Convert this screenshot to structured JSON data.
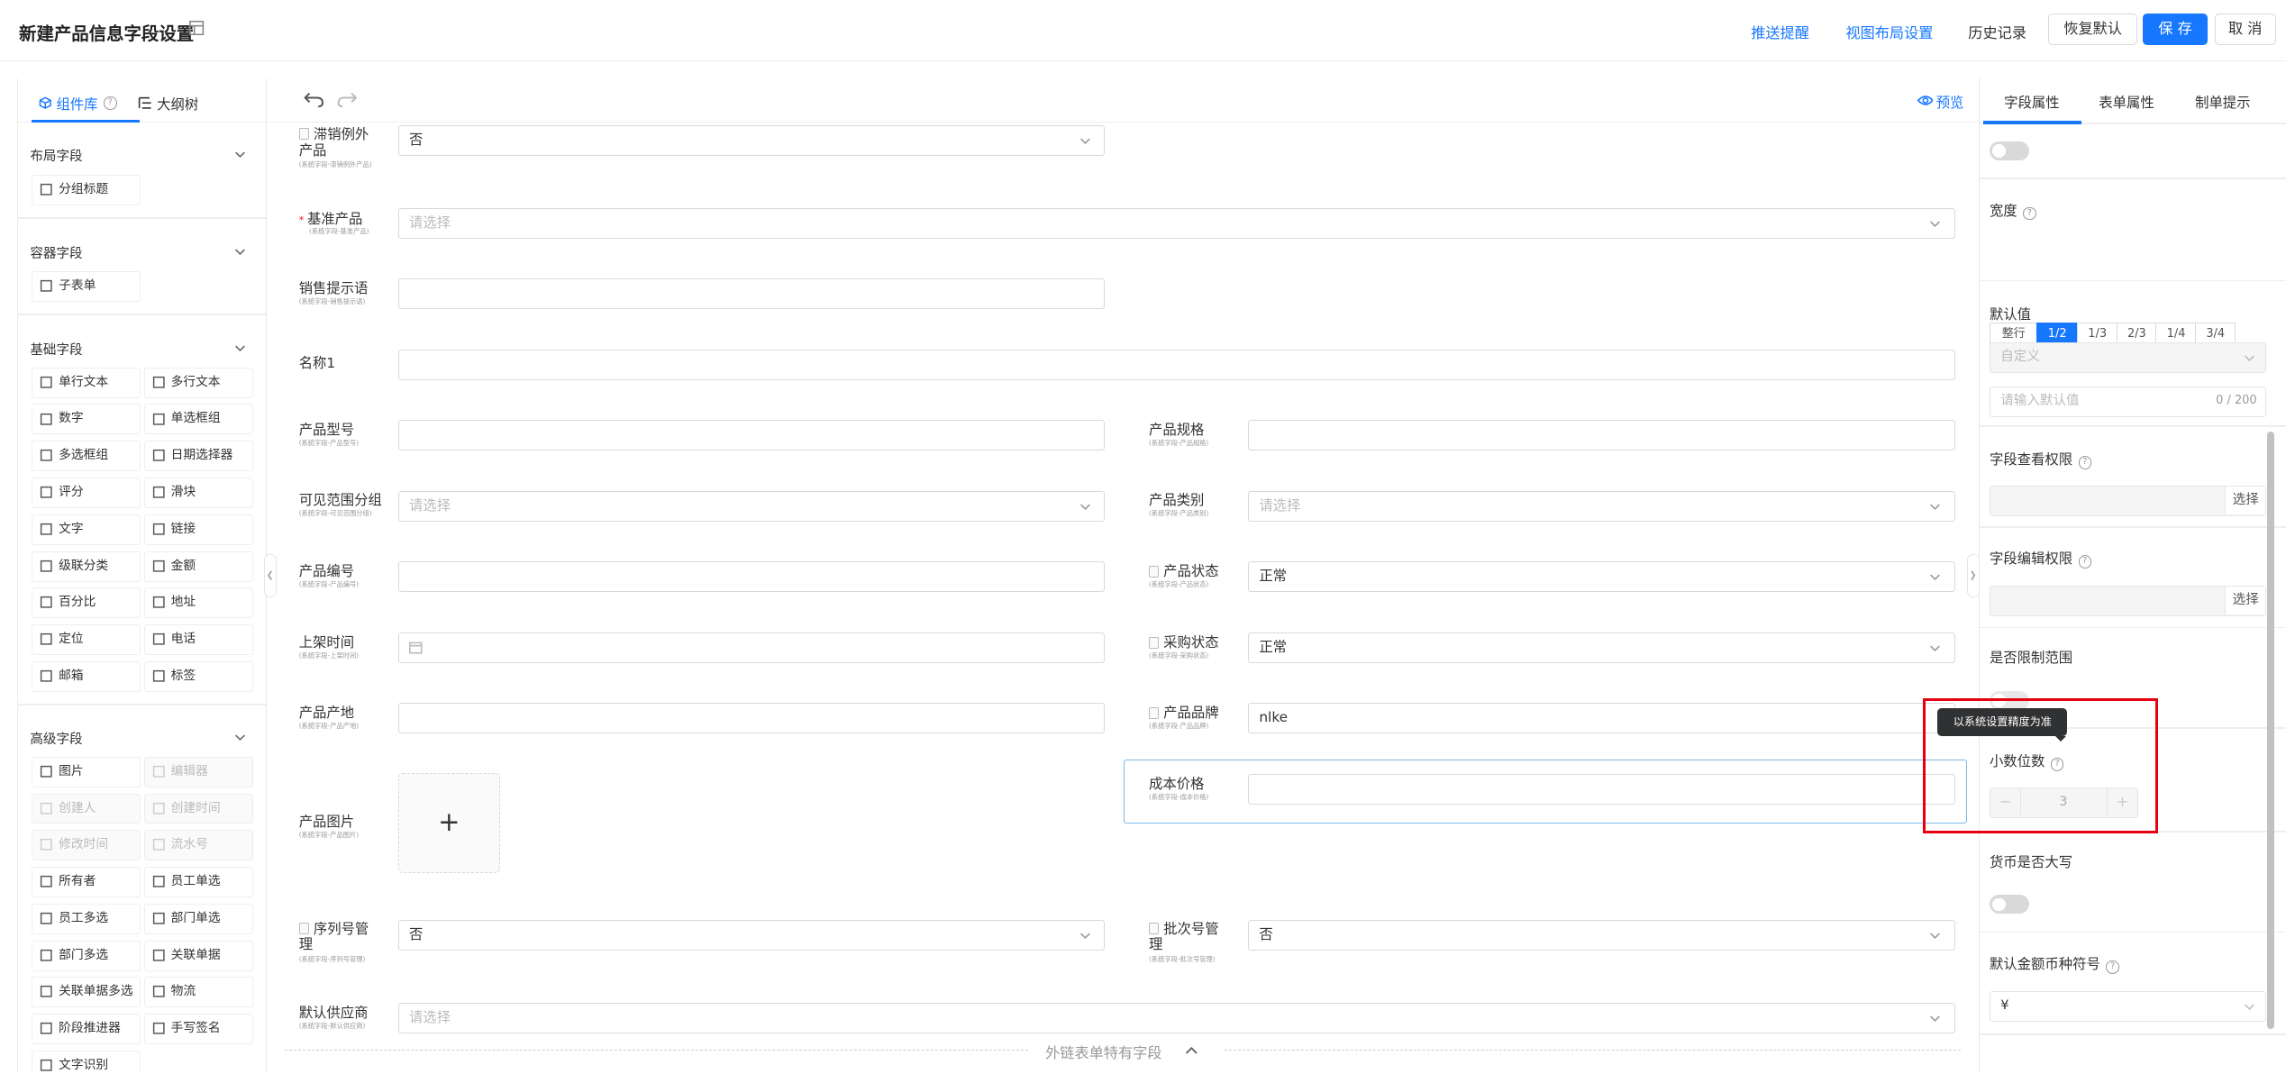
{
  "header": {
    "title": "新建产品信息字段设置",
    "push_reminder": "推送提醒",
    "view_layout": "视图布局设置",
    "history": "历史记录",
    "restore_default": "恢复默认",
    "save": "保 存",
    "cancel": "取 消"
  },
  "left_panel": {
    "tab_components": "组件库",
    "tab_outline": "大纲树",
    "groups": [
      {
        "title": "布局字段",
        "items": [
          {
            "label": "分组标题",
            "icon": "group-title-icon"
          }
        ]
      },
      {
        "title": "容器字段",
        "items": [
          {
            "label": "子表单",
            "icon": "table-icon"
          }
        ]
      },
      {
        "title": "基础字段",
        "items": [
          {
            "label": "单行文本",
            "icon": "single-line-icon"
          },
          {
            "label": "多行文本",
            "icon": "multi-line-icon"
          },
          {
            "label": "数字",
            "icon": "number-icon"
          },
          {
            "label": "单选框组",
            "icon": "radio-icon"
          },
          {
            "label": "多选框组",
            "icon": "checkbox-icon"
          },
          {
            "label": "日期选择器",
            "icon": "calendar-icon"
          },
          {
            "label": "评分",
            "icon": "star-icon"
          },
          {
            "label": "滑块",
            "icon": "slider-icon"
          },
          {
            "label": "文字",
            "icon": "text-icon"
          },
          {
            "label": "链接",
            "icon": "link-icon"
          },
          {
            "label": "级联分类",
            "icon": "cascade-icon"
          },
          {
            "label": "金额",
            "icon": "money-icon"
          },
          {
            "label": "百分比",
            "icon": "percent-icon"
          },
          {
            "label": "地址",
            "icon": "location-icon"
          },
          {
            "label": "定位",
            "icon": "position-icon"
          },
          {
            "label": "电话",
            "icon": "phone-icon"
          },
          {
            "label": "邮箱",
            "icon": "mail-icon"
          },
          {
            "label": "标签",
            "icon": "tag-icon"
          }
        ]
      },
      {
        "title": "高级字段",
        "items": [
          {
            "label": "图片",
            "icon": "image-icon",
            "disabled": false
          },
          {
            "label": "编辑器",
            "icon": "editor-icon",
            "disabled": true
          },
          {
            "label": "创建人",
            "icon": "creator-icon",
            "disabled": true
          },
          {
            "label": "创建时间",
            "icon": "clock-icon",
            "disabled": true
          },
          {
            "label": "修改时间",
            "icon": "clock-icon",
            "disabled": true
          },
          {
            "label": "流水号",
            "icon": "serial-icon",
            "disabled": true
          },
          {
            "label": "所有者",
            "icon": "owner-icon",
            "disabled": false
          },
          {
            "label": "员工单选",
            "icon": "user-icon",
            "disabled": false
          },
          {
            "label": "员工多选",
            "icon": "users-icon",
            "disabled": false
          },
          {
            "label": "部门单选",
            "icon": "dept-icon",
            "disabled": false
          },
          {
            "label": "部门多选",
            "icon": "dept-icon",
            "disabled": false
          },
          {
            "label": "关联单据",
            "icon": "link-icon",
            "disabled": false
          },
          {
            "label": "关联单据多选",
            "icon": "link-icon",
            "disabled": false
          },
          {
            "label": "物流",
            "icon": "truck-icon",
            "disabled": false
          },
          {
            "label": "阶段推进器",
            "icon": "stage-icon",
            "disabled": false
          },
          {
            "label": "手写签名",
            "icon": "signature-icon",
            "disabled": false
          },
          {
            "label": "文字识别",
            "icon": "ocr-icon",
            "disabled": false
          }
        ]
      }
    ]
  },
  "toolbar": {
    "preview": "预览"
  },
  "form": {
    "fields": {
      "exempt": {
        "label1": "滞销例外",
        "label2": "产品",
        "sub": "(系统字段-滞销例外产品)",
        "value": "否"
      },
      "base_product": {
        "label": "基准产品",
        "sub": "(系统字段-基准产品)",
        "placeholder": "请选择"
      },
      "sales_tip": {
        "label": "销售提示语",
        "sub": "(系统字段-销售提示语)",
        "value": ""
      },
      "name1": {
        "label": "名称1",
        "value": ""
      },
      "model": {
        "label": "产品型号",
        "sub": "(系统字段-产品型号)",
        "value": ""
      },
      "spec": {
        "label": "产品规格",
        "sub": "(系统字段-产品规格)",
        "value": ""
      },
      "visible_group": {
        "label": "可见范围分组",
        "sub": "(系统字段-可见范围分组)",
        "placeholder": "请选择"
      },
      "category": {
        "label": "产品类别",
        "sub": "(系统字段-产品类别)",
        "placeholder": "请选择"
      },
      "code": {
        "label": "产品编号",
        "sub": "(系统字段-产品编号)",
        "value": ""
      },
      "status": {
        "label": "产品状态",
        "sub": "(系统字段-产品状态)",
        "value": "正常"
      },
      "shelf_time": {
        "label": "上架时间",
        "sub": "(系统字段-上架时间)",
        "value": ""
      },
      "purchase_status": {
        "label": "采购状态",
        "sub": "(系统字段-采购状态)",
        "value": "正常"
      },
      "origin": {
        "label": "产品产地",
        "sub": "(系统字段-产品产地)",
        "value": ""
      },
      "brand": {
        "label": "产品品牌",
        "sub": "(系统字段-产品品牌)",
        "value": "nlke"
      },
      "cost": {
        "label": "成本价格",
        "sub": "(系统字段-成本价格)",
        "value": ""
      },
      "image": {
        "label": "产品图片",
        "sub": "(系统字段-产品图片)",
        "plus": "+"
      },
      "serial_mgmt": {
        "label1": "序列号管",
        "label2": "理",
        "sub": "(系统字段-序列号管理)",
        "value": "否"
      },
      "batch_mgmt": {
        "label1": "批次号管",
        "label2": "理",
        "sub": "(系统字段-批次号管理)",
        "value": "否"
      },
      "supplier": {
        "label": "默认供应商",
        "sub": "(系统字段-默认供应商)",
        "placeholder": "请选择"
      }
    },
    "footer_divider": "外链表单特有字段"
  },
  "right_panel": {
    "tabs": [
      "字段属性",
      "表单属性",
      "制单提示"
    ],
    "width_label": "宽度",
    "width_options": [
      "整行",
      "1/2",
      "1/3",
      "2/3",
      "1/4",
      "3/4"
    ],
    "width_selected": "1/2",
    "default_label": "默认值",
    "default_type": "自定义",
    "default_placeholder": "请输入默认值",
    "default_count": "0 / 200",
    "view_perm_label": "字段查看权限",
    "edit_perm_label": "字段编辑权限",
    "pick": "选择",
    "limit_range_label": "是否限制范围",
    "decimal_label": "小数位数",
    "decimal_value": "3",
    "tooltip": "以系统设置精度为准",
    "currency_upper_label": "货币是否大写",
    "currency_symbol_label": "默认金额币种符号",
    "currency_symbol_value": "¥"
  }
}
